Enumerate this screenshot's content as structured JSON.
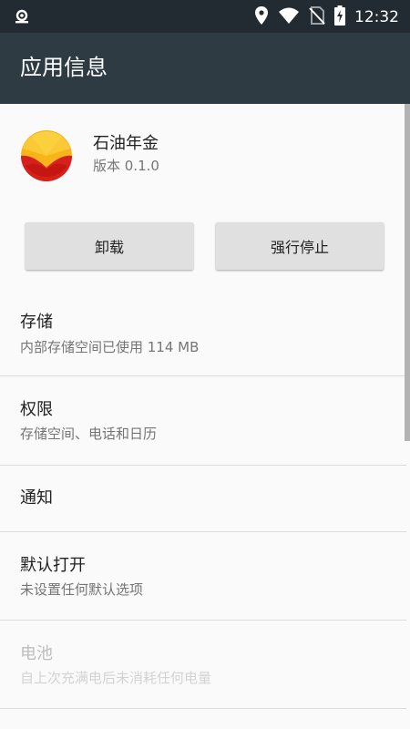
{
  "status_bar": {
    "time": "12:32",
    "icons": [
      "location-icon",
      "wifi-icon",
      "no-sim-icon",
      "battery-charging-icon"
    ],
    "left_icon": "notification-icon"
  },
  "app_bar": {
    "title": "应用信息"
  },
  "app": {
    "name": "石油年金",
    "version": "版本 0.1.0",
    "logo_icon": "petrochina-logo-icon"
  },
  "buttons": {
    "uninstall": "卸载",
    "force_stop": "强行停止"
  },
  "settings": [
    {
      "title": "存储",
      "summary": "内部存储空间已使用 114 MB",
      "enabled": true
    },
    {
      "title": "权限",
      "summary": "存储空间、电话和日历",
      "enabled": true
    },
    {
      "title": "通知",
      "summary": "",
      "enabled": true
    },
    {
      "title": "默认打开",
      "summary": "未设置任何默认选项",
      "enabled": true
    },
    {
      "title": "电池",
      "summary": "自上次充满电后未消耗任何电量",
      "enabled": false
    }
  ],
  "colors": {
    "status_bar": "#212b31",
    "app_bar": "#2e3b42",
    "background": "#fafafa",
    "button": "#e0e0e0",
    "logo_red": "#d6201b",
    "logo_yellow": "#f7b51a"
  }
}
